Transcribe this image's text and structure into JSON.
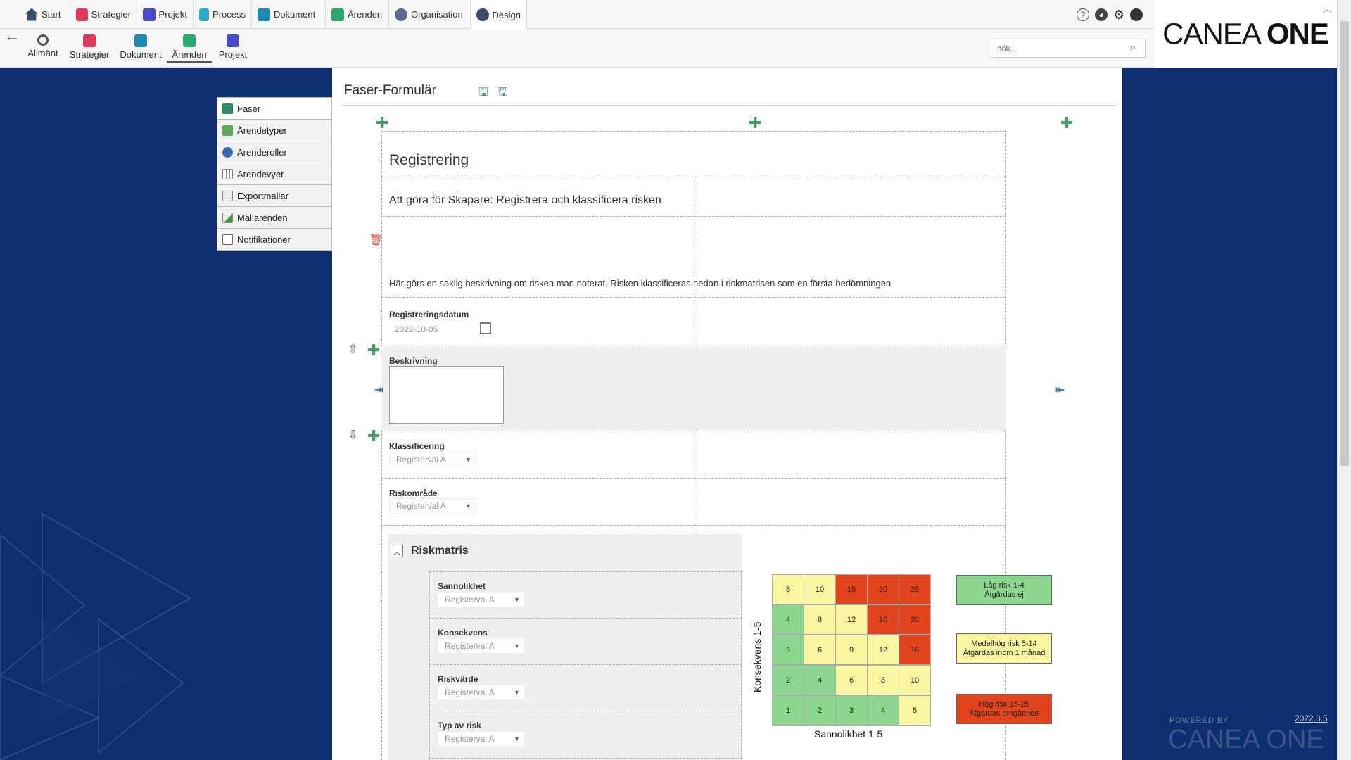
{
  "nav_top": [
    {
      "label": "Start",
      "color": "#3a4a6a"
    },
    {
      "label": "Strategier",
      "color": "#e03a5a"
    },
    {
      "label": "Projekt",
      "color": "#4a4acc"
    },
    {
      "label": "Process",
      "color": "#2fa8c8"
    },
    {
      "label": "Dokument",
      "color": "#1a8ab0"
    },
    {
      "label": "Ärenden",
      "color": "#2aaa6a"
    },
    {
      "label": "Organisation",
      "color": "#5a6a8a"
    },
    {
      "label": "Design",
      "color": "#3a4a6a"
    }
  ],
  "nav_sub": [
    {
      "label": "Allmänt",
      "color": "#555"
    },
    {
      "label": "Strategier",
      "color": "#e03a5a"
    },
    {
      "label": "Dokument",
      "color": "#1a8ab0"
    },
    {
      "label": "Ärenden",
      "color": "#2aaa6a"
    },
    {
      "label": "Projekt",
      "color": "#4a4acc"
    }
  ],
  "search": {
    "placeholder": "sök..."
  },
  "logo": {
    "left": "CANEA",
    "right": "ONE"
  },
  "sidemenu": [
    {
      "label": "Faser"
    },
    {
      "label": "Ärendetyper"
    },
    {
      "label": "Ärenderoller"
    },
    {
      "label": "Ärendevyer"
    },
    {
      "label": "Exportmallar"
    },
    {
      "label": "Mallärenden"
    },
    {
      "label": "Notifikationer"
    }
  ],
  "form": {
    "title": "Faser-Formulär",
    "section_title": "Registrering",
    "todo": "Att göra för Skapare: Registrera och klassificera risken",
    "description_text": "Här görs en saklig beskrivning om risken man noterat. Risken klassificeras nedan i riskmatrisen som en första bedömningen",
    "reg_date_label": "Registreringsdatum",
    "reg_date_value": "2022-10-05",
    "beskrivning_label": "Beskrivning",
    "klass_label": "Klassificering",
    "klass_value": "Registerval A",
    "riskomrade_label": "Riskområde",
    "riskomrade_value": "Registerval A",
    "riskmatris_title": "Riskmatris",
    "sub_fields": [
      {
        "label": "Sannolikhet",
        "value": "Registerval A"
      },
      {
        "label": "Konsekvens",
        "value": "Registerval A"
      },
      {
        "label": "Riskvärde",
        "value": "Registerval A"
      },
      {
        "label": "Typ av risk",
        "value": "Registerval A"
      }
    ]
  },
  "matrix": {
    "ylabel": "Konsekvens 1-5",
    "xlabel": "Sannolikhet 1-5",
    "rows": [
      [
        "5",
        "10",
        "15",
        "20",
        "25"
      ],
      [
        "4",
        "8",
        "12",
        "16",
        "20"
      ],
      [
        "3",
        "6",
        "9",
        "12",
        "15"
      ],
      [
        "2",
        "4",
        "6",
        "8",
        "10"
      ],
      [
        "1",
        "2",
        "3",
        "4",
        "5"
      ]
    ],
    "colors": [
      [
        "y",
        "y",
        "r",
        "r",
        "r"
      ],
      [
        "g",
        "y",
        "y",
        "r",
        "r"
      ],
      [
        "g",
        "y",
        "y",
        "y",
        "r"
      ],
      [
        "g",
        "g",
        "y",
        "y",
        "y"
      ],
      [
        "g",
        "g",
        "g",
        "g",
        "y"
      ]
    ],
    "legend": [
      {
        "l1": "Låg risk 1-4",
        "l2": "Åtgärdas ej",
        "color": "#8cd68f"
      },
      {
        "l1": "Medelhög risk 5-14",
        "l2": "Åtgärdas inom 1 månad",
        "color": "#fbf6a2"
      },
      {
        "l1": "Hög risk 15-25",
        "l2": "Åtgärdas omgående",
        "color": "#e2451e"
      }
    ]
  },
  "footer": {
    "version": "2022.3.5",
    "powered": "POWERED BY",
    "powered_logo": "CANEA ONE"
  }
}
